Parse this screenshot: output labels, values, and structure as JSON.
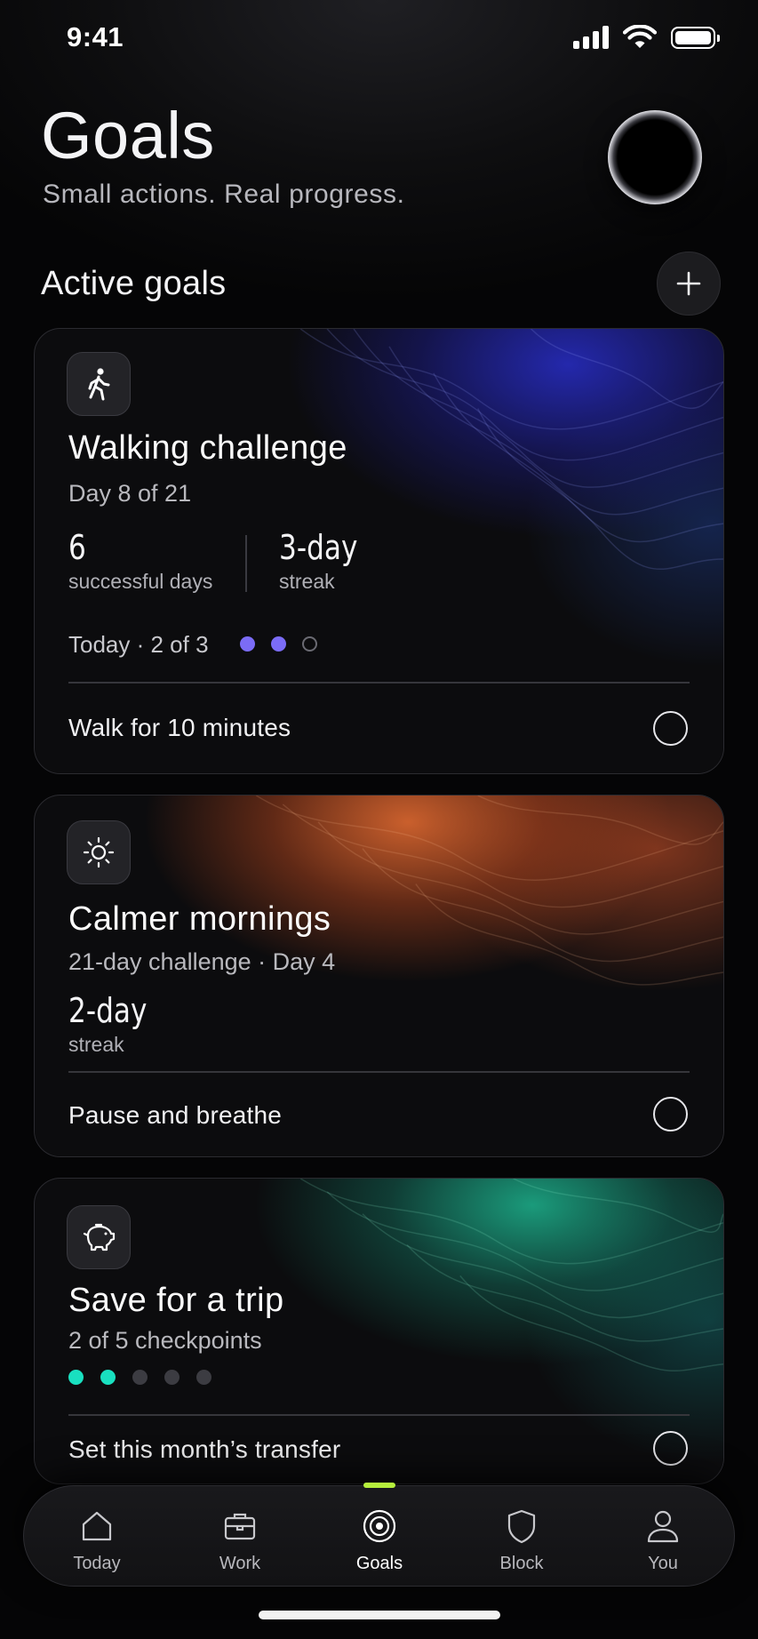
{
  "status": {
    "time": "9:41"
  },
  "header": {
    "title": "Goals",
    "subtitle": "Small actions. Real progress."
  },
  "section": {
    "title": "Active goals",
    "add_icon": "plus-icon"
  },
  "colors": {
    "walking_accent": "#7b6cf6",
    "savings_accent": "#19e0c0",
    "tab_active_indicator": "#b6f03c",
    "inactive_dot": "#3c3c42"
  },
  "goals": [
    {
      "icon": "walking-person-icon",
      "title": "Walking challenge",
      "subtitle": "Day 8 of 21",
      "stats": [
        {
          "value": "6",
          "label": "successful days"
        },
        {
          "value": "3-day",
          "label": "streak"
        }
      ],
      "today": "Today · 2 of 3",
      "today_progress": {
        "done": 2,
        "total": 3
      },
      "task": "Walk for 10 minutes",
      "task_done": false
    },
    {
      "icon": "sun-icon",
      "title": "Calmer mornings",
      "subtitle": "21-day challenge · Day 4",
      "stats": [
        {
          "value": "2-day",
          "label": "streak"
        }
      ],
      "task": "Pause and breathe",
      "task_done": false
    },
    {
      "icon": "piggy-bank-icon",
      "title": "Save for a trip",
      "subtitle": "2 of 5 checkpoints",
      "checkpoints": {
        "done": 2,
        "total": 5
      },
      "task": "Set this month’s transfer",
      "task_done": false
    }
  ],
  "tabs": [
    {
      "label": "Today",
      "icon": "home-icon",
      "active": false
    },
    {
      "label": "Work",
      "icon": "briefcase-icon",
      "active": false
    },
    {
      "label": "Goals",
      "icon": "target-icon",
      "active": true
    },
    {
      "label": "Block",
      "icon": "shield-icon",
      "active": false
    },
    {
      "label": "You",
      "icon": "person-icon",
      "active": false
    }
  ]
}
